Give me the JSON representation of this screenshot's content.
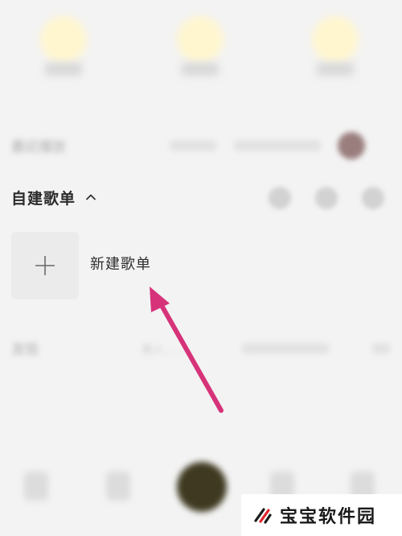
{
  "recent": {
    "title": "最近播放"
  },
  "playlists": {
    "section_title": "自建歌单",
    "new_playlist_label": "新建歌单"
  },
  "discover": {
    "title": "发现",
    "hint": "真人……"
  },
  "watermark": {
    "text": "宝宝软件园"
  },
  "colors": {
    "arrow": "#d6337a",
    "background": "#f3f3f3"
  }
}
